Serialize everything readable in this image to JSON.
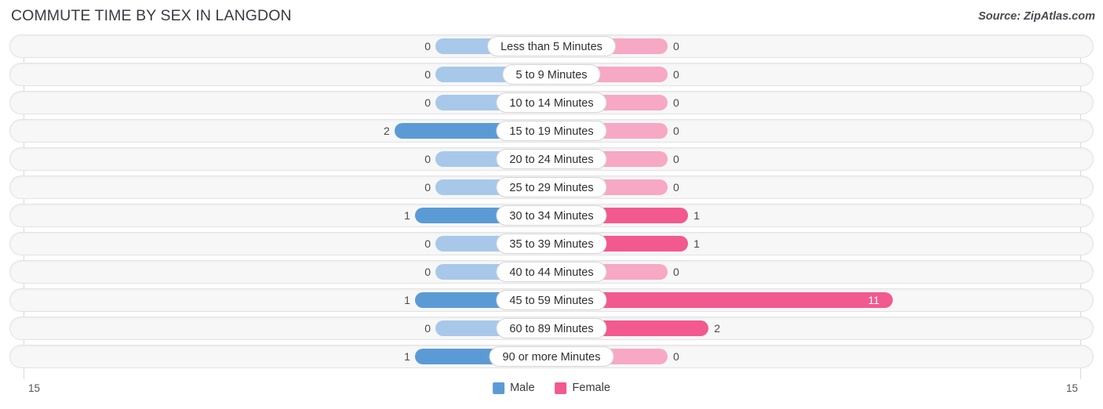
{
  "header": {
    "title": "COMMUTE TIME BY SEX IN LANGDON",
    "source": "Source: ZipAtlas.com"
  },
  "colors": {
    "male_strong": "#5b9bd5",
    "male_light": "#a8c8ea",
    "female_strong": "#f2598f",
    "female_light": "#f7a8c4",
    "track_fill": "#f7f7f7",
    "track_border": "#e3e3e3",
    "gridline": "#d9d9d9"
  },
  "legend": {
    "items": [
      {
        "label": "Male",
        "color": "#5b9bd5"
      },
      {
        "label": "Female",
        "color": "#f2598f"
      }
    ]
  },
  "axis": {
    "left_label": "15",
    "right_label": "15",
    "max": 15
  },
  "chart_data": {
    "type": "bar",
    "title": "COMMUTE TIME BY SEX IN LANGDON",
    "subtitle": "Source: ZipAtlas.com",
    "orientation": "horizontal",
    "layout": "diverging-bidirectional",
    "xlabel": "",
    "ylabel": "",
    "xlim": [
      15,
      15
    ],
    "grid": true,
    "legend_position": "bottom-center",
    "categories": [
      "Less than 5 Minutes",
      "5 to 9 Minutes",
      "10 to 14 Minutes",
      "15 to 19 Minutes",
      "20 to 24 Minutes",
      "25 to 29 Minutes",
      "30 to 34 Minutes",
      "35 to 39 Minutes",
      "40 to 44 Minutes",
      "45 to 59 Minutes",
      "60 to 89 Minutes",
      "90 or more Minutes"
    ],
    "series": [
      {
        "name": "Male",
        "direction": "left",
        "color": "#5b9bd5",
        "values": [
          0,
          0,
          0,
          2,
          0,
          0,
          1,
          0,
          0,
          1,
          0,
          1
        ]
      },
      {
        "name": "Female",
        "direction": "right",
        "color": "#f2598f",
        "values": [
          0,
          0,
          0,
          0,
          0,
          0,
          1,
          1,
          0,
          11,
          2,
          0
        ]
      }
    ]
  },
  "rows": [
    {
      "label": "Less than 5 Minutes",
      "male": "0",
      "female": "0",
      "male_value": 0,
      "female_value": 0
    },
    {
      "label": "5 to 9 Minutes",
      "male": "0",
      "female": "0",
      "male_value": 0,
      "female_value": 0
    },
    {
      "label": "10 to 14 Minutes",
      "male": "0",
      "female": "0",
      "male_value": 0,
      "female_value": 0
    },
    {
      "label": "15 to 19 Minutes",
      "male": "2",
      "female": "0",
      "male_value": 2,
      "female_value": 0
    },
    {
      "label": "20 to 24 Minutes",
      "male": "0",
      "female": "0",
      "male_value": 0,
      "female_value": 0
    },
    {
      "label": "25 to 29 Minutes",
      "male": "0",
      "female": "0",
      "male_value": 0,
      "female_value": 0
    },
    {
      "label": "30 to 34 Minutes",
      "male": "1",
      "female": "1",
      "male_value": 1,
      "female_value": 1
    },
    {
      "label": "35 to 39 Minutes",
      "male": "0",
      "female": "1",
      "male_value": 0,
      "female_value": 1
    },
    {
      "label": "40 to 44 Minutes",
      "male": "0",
      "female": "0",
      "male_value": 0,
      "female_value": 0
    },
    {
      "label": "45 to 59 Minutes",
      "male": "1",
      "female": "11",
      "male_value": 1,
      "female_value": 11
    },
    {
      "label": "60 to 89 Minutes",
      "male": "0",
      "female": "2",
      "male_value": 0,
      "female_value": 2
    },
    {
      "label": "90 or more Minutes",
      "male": "1",
      "female": "0",
      "male_value": 1,
      "female_value": 0
    }
  ]
}
